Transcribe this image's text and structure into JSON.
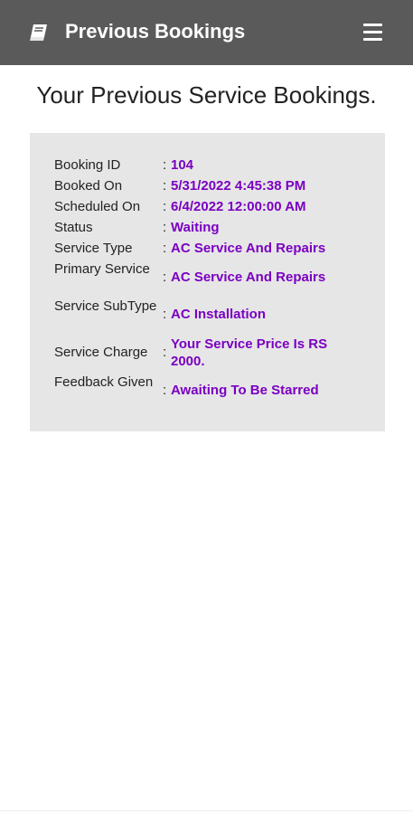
{
  "appbar": {
    "title": "Previous Bookings",
    "left_icon": "book-icon",
    "menu_icon": "hamburger-menu-icon"
  },
  "page": {
    "heading": "Your Previous Service Bookings."
  },
  "booking": {
    "fields": [
      {
        "label": "Booking ID",
        "value": "104"
      },
      {
        "label": "Booked On",
        "value": "5/31/2022 4:45:38 PM"
      },
      {
        "label": "Scheduled On",
        "value": "6/4/2022 12:00:00 AM"
      },
      {
        "label": "Status",
        "value": "Waiting"
      },
      {
        "label": "Service Type",
        "value": "AC Service And Repairs"
      },
      {
        "label": "Primary Service",
        "value": "AC Service And Repairs"
      },
      {
        "label": "Service SubType",
        "value": "AC Installation"
      },
      {
        "label": "Service Charge",
        "value": "Your Service Price Is RS 2000."
      },
      {
        "label": "Feedback Given",
        "value": "Awaiting To Be Starred"
      }
    ],
    "separator": ":"
  },
  "colors": {
    "appbar": "#5a5a5a",
    "value_text": "#7a00c2",
    "card_bg": "#e6e6e6"
  }
}
